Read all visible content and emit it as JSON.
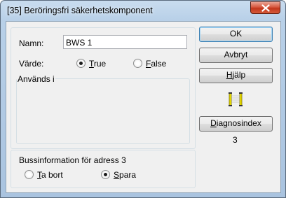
{
  "window": {
    "title": "[35] Beröringsfri säkerhetskomponent"
  },
  "form": {
    "name_label": "Namn:",
    "name_value": "BWS 1",
    "value_label": "Värde:",
    "radio_true": {
      "mnemonic": "T",
      "rest": "rue",
      "checked": true
    },
    "radio_false": {
      "mnemonic": "F",
      "rest": "alse",
      "checked": false
    },
    "used_in_label": "Används i"
  },
  "bus": {
    "label": "Bussinformation för adress 3",
    "remove": {
      "mnemonic": "T",
      "rest": "a bort",
      "checked": false
    },
    "save": {
      "mnemonic": "S",
      "rest": "para",
      "checked": true
    }
  },
  "buttons": {
    "ok": "OK",
    "cancel": "Avbryt",
    "help": {
      "mnemonic": "H",
      "rest": "jälp"
    },
    "diag": {
      "mnemonic": "D",
      "rest": "iagnosindex"
    }
  },
  "diagnos_value": "3",
  "icons": {
    "close": "close-icon",
    "component": "safety-component-icon"
  },
  "colors": {
    "icon_yellow": "#f5e600",
    "close_red": "#c3361c"
  }
}
